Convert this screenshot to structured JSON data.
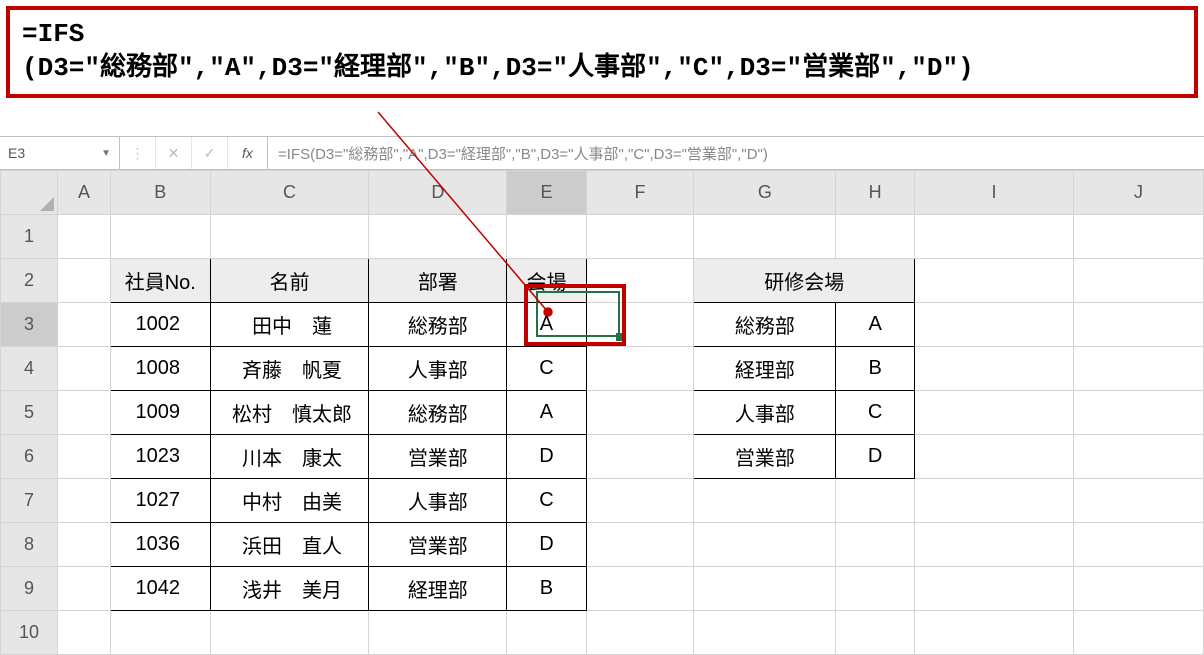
{
  "callout": {
    "line1": "=IFS",
    "line2": "(D3=\"総務部\",\"A\",D3=\"経理部\",\"B\",D3=\"人事部\",\"C\",D3=\"営業部\",\"D\")"
  },
  "name_box": {
    "value": "E3"
  },
  "fx_label": "fx",
  "formula_bar": {
    "value": "=IFS(D3=\"総務部\",\"A\",D3=\"経理部\",\"B\",D3=\"人事部\",\"C\",D3=\"営業部\",\"D\")"
  },
  "columns": [
    "A",
    "B",
    "C",
    "D",
    "E",
    "F",
    "G",
    "H",
    "I",
    "J"
  ],
  "rows": [
    "1",
    "2",
    "3",
    "4",
    "5",
    "6",
    "7",
    "8",
    "9",
    "10"
  ],
  "table1": {
    "headers": {
      "B": "社員No.",
      "C": "名前",
      "D": "部署",
      "E": "会場"
    },
    "rows": [
      {
        "no": "1002",
        "name": "田中　蓮",
        "dept": "総務部",
        "venue": "A"
      },
      {
        "no": "1008",
        "name": "斉藤　帆夏",
        "dept": "人事部",
        "venue": "C"
      },
      {
        "no": "1009",
        "name": "松村　慎太郎",
        "dept": "総務部",
        "venue": "A"
      },
      {
        "no": "1023",
        "name": "川本　康太",
        "dept": "営業部",
        "venue": "D"
      },
      {
        "no": "1027",
        "name": "中村　由美",
        "dept": "人事部",
        "venue": "C"
      },
      {
        "no": "1036",
        "name": "浜田　直人",
        "dept": "営業部",
        "venue": "D"
      },
      {
        "no": "1042",
        "name": "浅井　美月",
        "dept": "経理部",
        "venue": "B"
      }
    ]
  },
  "table2": {
    "header": "研修会場",
    "rows": [
      {
        "dept": "総務部",
        "code": "A"
      },
      {
        "dept": "経理部",
        "code": "B"
      },
      {
        "dept": "人事部",
        "code": "C"
      },
      {
        "dept": "営業部",
        "code": "D"
      }
    ]
  }
}
